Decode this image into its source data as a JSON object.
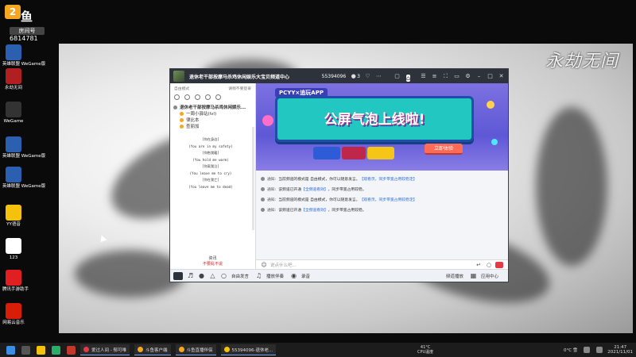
{
  "overlay": {
    "logo_mark": "2",
    "brand": "鱼",
    "room_label": "房间号",
    "room_number": "6814781"
  },
  "desktop_icons": [
    {
      "label": "英雄联盟 WeGame版",
      "color": "#2b5fb0"
    },
    {
      "label": "永劫无间",
      "color": "#b02020"
    },
    {
      "label": "WeGame",
      "color": "#333333"
    },
    {
      "label": "英雄联盟 WeGame版",
      "color": "#2b5fb0"
    },
    {
      "label": "英雄联盟 WeGame版",
      "color": "#2b5fb0"
    },
    {
      "label": "YY语音",
      "color": "#f4c20d"
    },
    {
      "label": "123",
      "color": "#ffffff"
    },
    {
      "label": "腾讯手游助手",
      "color": "#e02020"
    },
    {
      "label": "网易云音乐",
      "color": "#d81e06"
    }
  ],
  "wallpaper": {
    "title": "永劫无间"
  },
  "app": {
    "title": "退休老干部按摩马杀鸡休闲娱乐大宝贝频道中心",
    "channel_id": "55394096",
    "user_count": "3",
    "titlebar_icons": [
      "user-icon",
      "heart-icon",
      "more-icon",
      "video-icon",
      "home-icon",
      "list-icon",
      "menu-icon",
      "gamepad-icon",
      "screen-icon",
      "minimize-icon",
      "maximize-icon",
      "close-icon"
    ],
    "sidebar": {
      "mode": "自由模式",
      "mode_right": "请稍不要登录",
      "tree": [
        {
          "label": "退休老干部按摩马杀鸡休闲娱乐...",
          "color": "#888"
        },
        {
          "label": "一周小驿站(lvl)",
          "color": "#f5a623"
        },
        {
          "label": "律比本",
          "color": "#f5a623"
        },
        {
          "label": "查丽加",
          "color": "#f5a623"
        }
      ],
      "lyrics": [
        "[你在身边]",
        "(You are in my safety)",
        "[你抱我暖]",
        "(You hold me warm)",
        "[你离我泣]",
        "(You leave me to cry)",
        "[你在我亡]",
        "(You leave me to dead)"
      ],
      "bottom_label": "资讯",
      "bottom_warning": "不要乱不说"
    },
    "banner": {
      "tag": "PCYY×追玩APP",
      "headline": "公屏气泡上线啦!",
      "button": "立即体验"
    },
    "notices": [
      {
        "label": "通知:",
        "text": "当前频道的模式是 自由模式，你可以随意发言。",
        "link": "【观看页，同步带宽占用较稳定】"
      },
      {
        "label": "通知:",
        "text": "该频道已开通",
        "link": "【全频道看效】",
        "tail": "，同步带宽占用较稳。"
      },
      {
        "label": "通知:",
        "text": "当前频道的模式是 自由模式，你可以随意发言。",
        "link": "【观看页，同步带宽占用较稳定】"
      },
      {
        "label": "通知:",
        "text": "该频道已开通",
        "link": "【全频道看效】",
        "tail": "，同步带宽占用较稳。"
      }
    ],
    "chat_input": {
      "placeholder": "说点什么吧..."
    },
    "bottom_bar": {
      "items": [
        "自由发言",
        "播放伴奏",
        "录音"
      ],
      "right_items": [
        "频道播放",
        "应用中心"
      ]
    }
  },
  "taskbar": {
    "items": [
      {
        "label": "爱过人间 - 郁可唯",
        "color": "#e63946"
      },
      {
        "label": "斗鱼客户端",
        "color": "#f5a623"
      },
      {
        "label": "斗鱼直播伴侣",
        "color": "#f5a623"
      },
      {
        "label": "55394096-退休老...",
        "color": "#f4c20d"
      }
    ],
    "cpu_temp": "41°C",
    "cpu_label": "CPU温度",
    "weather": "0°C 雪",
    "time": "21:47",
    "date": "2021/11/01"
  }
}
